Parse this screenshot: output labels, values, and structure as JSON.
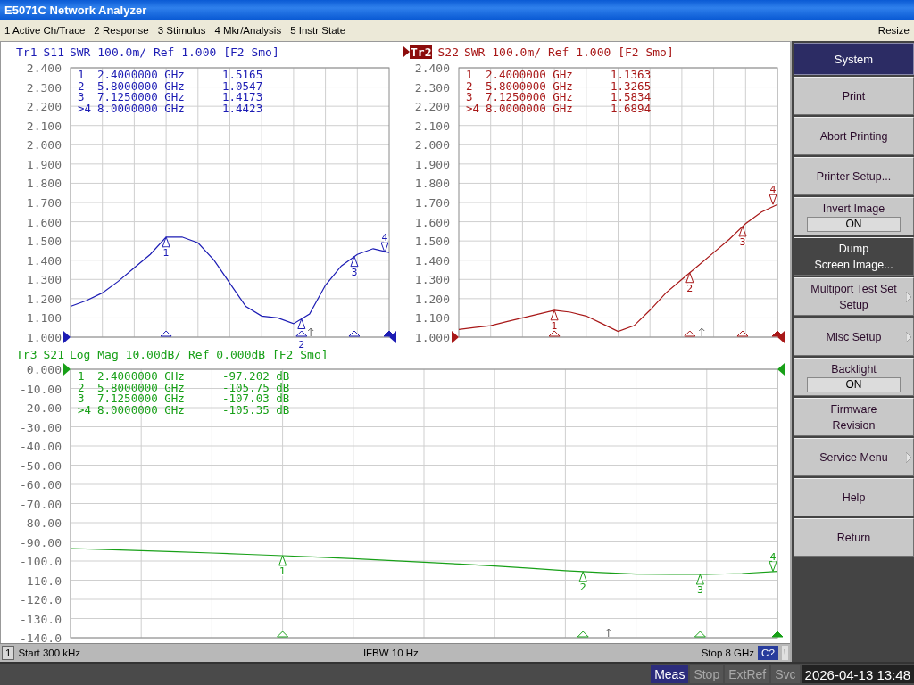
{
  "window": {
    "title": "E5071C Network Analyzer"
  },
  "menu": {
    "items": [
      "1 Active Ch/Trace",
      "2 Response",
      "3 Stimulus",
      "4 Mkr/Analysis",
      "5 Instr State"
    ],
    "resize": "Resize"
  },
  "panels": [
    {
      "trace": "Tr1",
      "active": false,
      "header": "SWR 100.0m/ Ref 1.000 [F2 Smo]",
      "marker_table": [
        {
          "marker": "1",
          "frequency": "2.4000000 GHz",
          "value": "1.5165"
        },
        {
          "marker": "2",
          "frequency": "5.8000000 GHz",
          "value": "1.0547"
        },
        {
          "marker": "3",
          "frequency": "7.1250000 GHz",
          "value": "1.4173"
        },
        {
          "marker": ">4",
          "frequency": "8.0000000 GHz",
          "value": "1.4423"
        }
      ],
      "markers": [
        {
          "label": "1",
          "active": false,
          "level": 0.3
        },
        {
          "label": "2",
          "active": false,
          "level": 0.725
        },
        {
          "label": "3",
          "active": false,
          "level": 0.890625
        },
        {
          "label": "4",
          "active": true,
          "level": 1.0
        }
      ],
      "reference": {
        "level": 0
      },
      "sweep_indicator": {
        "level": 0.754
      },
      "chart_data": {
        "type": "line",
        "categories": [
          null,
          null,
          null,
          null,
          null,
          null,
          null,
          null,
          null,
          null,
          null,
          null,
          null,
          null,
          null,
          null,
          null,
          null,
          null,
          null,
          null
        ],
        "ylim": [
          1.0,
          2.4
        ],
        "series": [
          {
            "name": "S11",
            "color": "#1c1cb4",
            "values": [
              1.16,
              1.19,
              1.23,
              1.29,
              1.36,
              1.43,
              1.52,
              1.52,
              1.49,
              1.4,
              1.28,
              1.16,
              1.11,
              1.1,
              1.07,
              1.12,
              1.27,
              1.37,
              1.43,
              1.46,
              1.44
            ]
          }
        ],
        "grid": true,
        "yticks": [
          {
            "value": 2.4,
            "label": "2.400"
          },
          {
            "value": 2.3,
            "label": "2.300"
          },
          {
            "value": 2.2,
            "label": "2.200"
          },
          {
            "value": 2.1,
            "label": "2.100"
          },
          {
            "value": 2.0,
            "label": "2.000"
          },
          {
            "value": 1.9,
            "label": "1.900"
          },
          {
            "value": 1.8,
            "label": "1.800"
          },
          {
            "value": 1.7,
            "label": "1.700"
          },
          {
            "value": 1.6,
            "label": "1.600"
          },
          {
            "value": 1.5,
            "label": "1.500"
          },
          {
            "value": 1.4,
            "label": "1.400"
          },
          {
            "value": 1.3,
            "label": "1.300"
          },
          {
            "value": 1.2,
            "label": "1.200"
          },
          {
            "value": 1.1,
            "label": "1.100"
          },
          {
            "value": 1.0,
            "label": "1.000"
          }
        ]
      }
    },
    {
      "trace": "Tr2",
      "active": true,
      "header": "SWR 100.0m/ Ref 1.000 [F2 Smo]",
      "marker_table": [
        {
          "marker": "1",
          "frequency": "2.4000000 GHz",
          "value": "1.1363"
        },
        {
          "marker": "2",
          "frequency": "5.8000000 GHz",
          "value": "1.3265"
        },
        {
          "marker": "3",
          "frequency": "7.1250000 GHz",
          "value": "1.5834"
        },
        {
          "marker": ">4",
          "frequency": "8.0000000 GHz",
          "value": "1.6894"
        }
      ],
      "markers": [
        {
          "label": "1",
          "active": false,
          "level": 0.3
        },
        {
          "label": "2",
          "active": false,
          "level": 0.725
        },
        {
          "label": "3",
          "active": false,
          "level": 0.890625
        },
        {
          "label": "4",
          "active": true,
          "level": 1.0
        }
      ],
      "reference": {
        "level": 0
      },
      "sweep_indicator": {
        "level": 0.7625
      },
      "chart_data": {
        "type": "line",
        "categories": [
          null,
          null,
          null,
          null,
          null,
          null,
          null,
          null,
          null,
          null,
          null,
          null,
          null,
          null,
          null,
          null,
          null,
          null,
          null,
          null,
          null
        ],
        "ylim": [
          1.0,
          2.4
        ],
        "series": [
          {
            "name": "S22",
            "color": "#a81818",
            "values": [
              1.04,
              1.05,
              1.06,
              1.08,
              1.1,
              1.12,
              1.14,
              1.13,
              1.11,
              1.07,
              1.03,
              1.06,
              1.14,
              1.23,
              1.3,
              1.37,
              1.44,
              1.51,
              1.59,
              1.65,
              1.69
            ]
          }
        ],
        "grid": true,
        "yticks": [
          {
            "value": 2.4,
            "label": "2.400"
          },
          {
            "value": 2.3,
            "label": "2.300"
          },
          {
            "value": 2.2,
            "label": "2.200"
          },
          {
            "value": 2.1,
            "label": "2.100"
          },
          {
            "value": 2.0,
            "label": "2.000"
          },
          {
            "value": 1.9,
            "label": "1.900"
          },
          {
            "value": 1.8,
            "label": "1.800"
          },
          {
            "value": 1.7,
            "label": "1.700"
          },
          {
            "value": 1.6,
            "label": "1.600"
          },
          {
            "value": 1.5,
            "label": "1.500"
          },
          {
            "value": 1.4,
            "label": "1.400"
          },
          {
            "value": 1.3,
            "label": "1.300"
          },
          {
            "value": 1.2,
            "label": "1.200"
          },
          {
            "value": 1.1,
            "label": "1.100"
          },
          {
            "value": 1.0,
            "label": "1.000"
          }
        ]
      }
    },
    {
      "trace": "Tr3",
      "active": false,
      "header": "Log Mag 10.00dB/ Ref 0.000dB [F2 Smo]",
      "marker_table": [
        {
          "marker": "1",
          "frequency": "2.4000000 GHz",
          "value": "-97.202 dB"
        },
        {
          "marker": "2",
          "frequency": "5.8000000 GHz",
          "value": "-105.75 dB"
        },
        {
          "marker": "3",
          "frequency": "7.1250000 GHz",
          "value": "-107.03 dB"
        },
        {
          "marker": ">4",
          "frequency": "8.0000000 GHz",
          "value": "-105.35 dB"
        }
      ],
      "markers": [
        {
          "label": "1",
          "active": false,
          "level": 0.3
        },
        {
          "label": "2",
          "active": false,
          "level": 0.725
        },
        {
          "label": "3",
          "active": false,
          "level": 0.890625
        },
        {
          "label": "4",
          "active": true,
          "level": 1.0
        }
      ],
      "reference": {
        "level": 1
      },
      "sweep_indicator": {
        "level": 0.761
      },
      "chart_data": {
        "type": "line",
        "categories": [
          null,
          null,
          null,
          null,
          null,
          null,
          null,
          null,
          null,
          null,
          null,
          null,
          null,
          null,
          null,
          null,
          null,
          null,
          null,
          null,
          null
        ],
        "ylim": [
          -140,
          0
        ],
        "series": [
          {
            "name": "S21",
            "color": "#18a018",
            "values": [
              -93.5,
              -94,
              -94.6,
              -95.2,
              -95.8,
              -96.5,
              -97.2,
              -98,
              -98.8,
              -99.7,
              -100.6,
              -101.6,
              -102.6,
              -103.8,
              -105,
              -106,
              -106.8,
              -107,
              -107,
              -106.5,
              -105.4
            ]
          }
        ],
        "grid": true,
        "yticks": [
          {
            "value": 0,
            "label": "0.000"
          },
          {
            "value": -10,
            "label": "-10.00"
          },
          {
            "value": -20,
            "label": "-20.00"
          },
          {
            "value": -30,
            "label": "-30.00"
          },
          {
            "value": -40,
            "label": "-40.00"
          },
          {
            "value": -50,
            "label": "-50.00"
          },
          {
            "value": -60,
            "label": "-60.00"
          },
          {
            "value": -70,
            "label": "-70.00"
          },
          {
            "value": -80,
            "label": "-80.00"
          },
          {
            "value": -90,
            "label": "-90.00"
          },
          {
            "value": -100,
            "label": "-100.0"
          },
          {
            "value": -110,
            "label": "-110.0"
          },
          {
            "value": -120,
            "label": "-120.0"
          },
          {
            "value": -130,
            "label": "-130.0"
          },
          {
            "value": -140,
            "label": "-140.0"
          }
        ]
      }
    }
  ],
  "channel_bar": {
    "channel": "1",
    "start": "Start 300 kHz",
    "ifbw": "IFBW 10 Hz",
    "stop": "Stop 8 GHz",
    "calibration": "C?",
    "warning": "!"
  },
  "softkeys": [
    {
      "kind": "header",
      "label": "System"
    },
    {
      "kind": "button",
      "label": "Print",
      "selected": false,
      "submenu": false
    },
    {
      "kind": "button",
      "label": "Abort Printing",
      "selected": false,
      "submenu": false
    },
    {
      "kind": "button",
      "label": "Printer Setup...",
      "selected": false,
      "submenu": false
    },
    {
      "kind": "toggle",
      "label": "Invert Image",
      "value": "ON",
      "selected": false,
      "submenu": false
    },
    {
      "kind": "button",
      "label": "Dump\nScreen Image...",
      "selected": true,
      "submenu": false
    },
    {
      "kind": "button",
      "label": "Multiport Test Set\nSetup",
      "selected": false,
      "submenu": true
    },
    {
      "kind": "button",
      "label": "Misc Setup",
      "selected": false,
      "submenu": true
    },
    {
      "kind": "toggle",
      "label": "Backlight",
      "value": "ON",
      "selected": false,
      "submenu": false
    },
    {
      "kind": "button",
      "label": "Firmware\nRevision",
      "selected": false,
      "submenu": false
    },
    {
      "kind": "button",
      "label": "Service Menu",
      "selected": false,
      "submenu": true
    },
    {
      "kind": "button",
      "label": "Help",
      "selected": false,
      "submenu": false
    },
    {
      "kind": "button",
      "label": "Return",
      "selected": false,
      "submenu": false
    }
  ],
  "status_bar": {
    "indicators": [
      {
        "label": "Meas",
        "on": true
      },
      {
        "label": "Stop",
        "on": false
      },
      {
        "label": "ExtRef",
        "on": false
      },
      {
        "label": "Svc",
        "on": false
      }
    ],
    "datetime": "2026-04-13 13:48"
  }
}
